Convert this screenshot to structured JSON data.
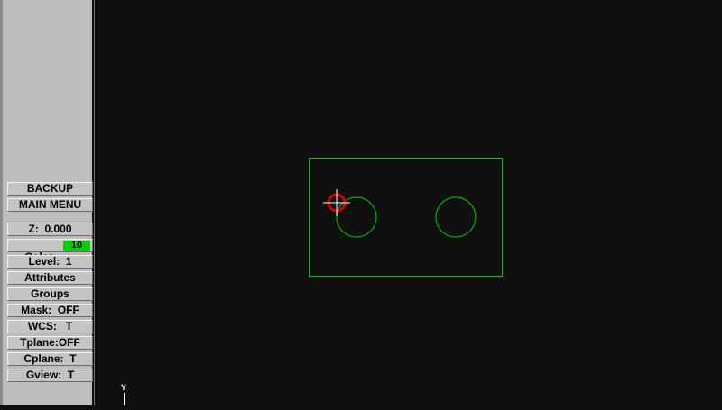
{
  "menu": {
    "backup": "BACKUP",
    "main_menu": "MAIN MENU",
    "z": "Z:  0.000",
    "color_label": "Color:",
    "color_value": "10",
    "level": "Level:  1",
    "attributes": "Attributes",
    "groups": "Groups",
    "mask": "Mask:  OFF",
    "wcs": "WCS:   T",
    "tplane": "Tplane:OFF",
    "cplane": "Cplane:  T",
    "gview": "Gview:  T"
  },
  "colors": {
    "geometry": "#00c800",
    "cursor_ring": "#d00000",
    "color_swatch": "#00d000",
    "background": "#101010"
  },
  "axis": {
    "y_label": "Y"
  },
  "icons": {
    "cursor": "crosshair-cursor-icon"
  }
}
